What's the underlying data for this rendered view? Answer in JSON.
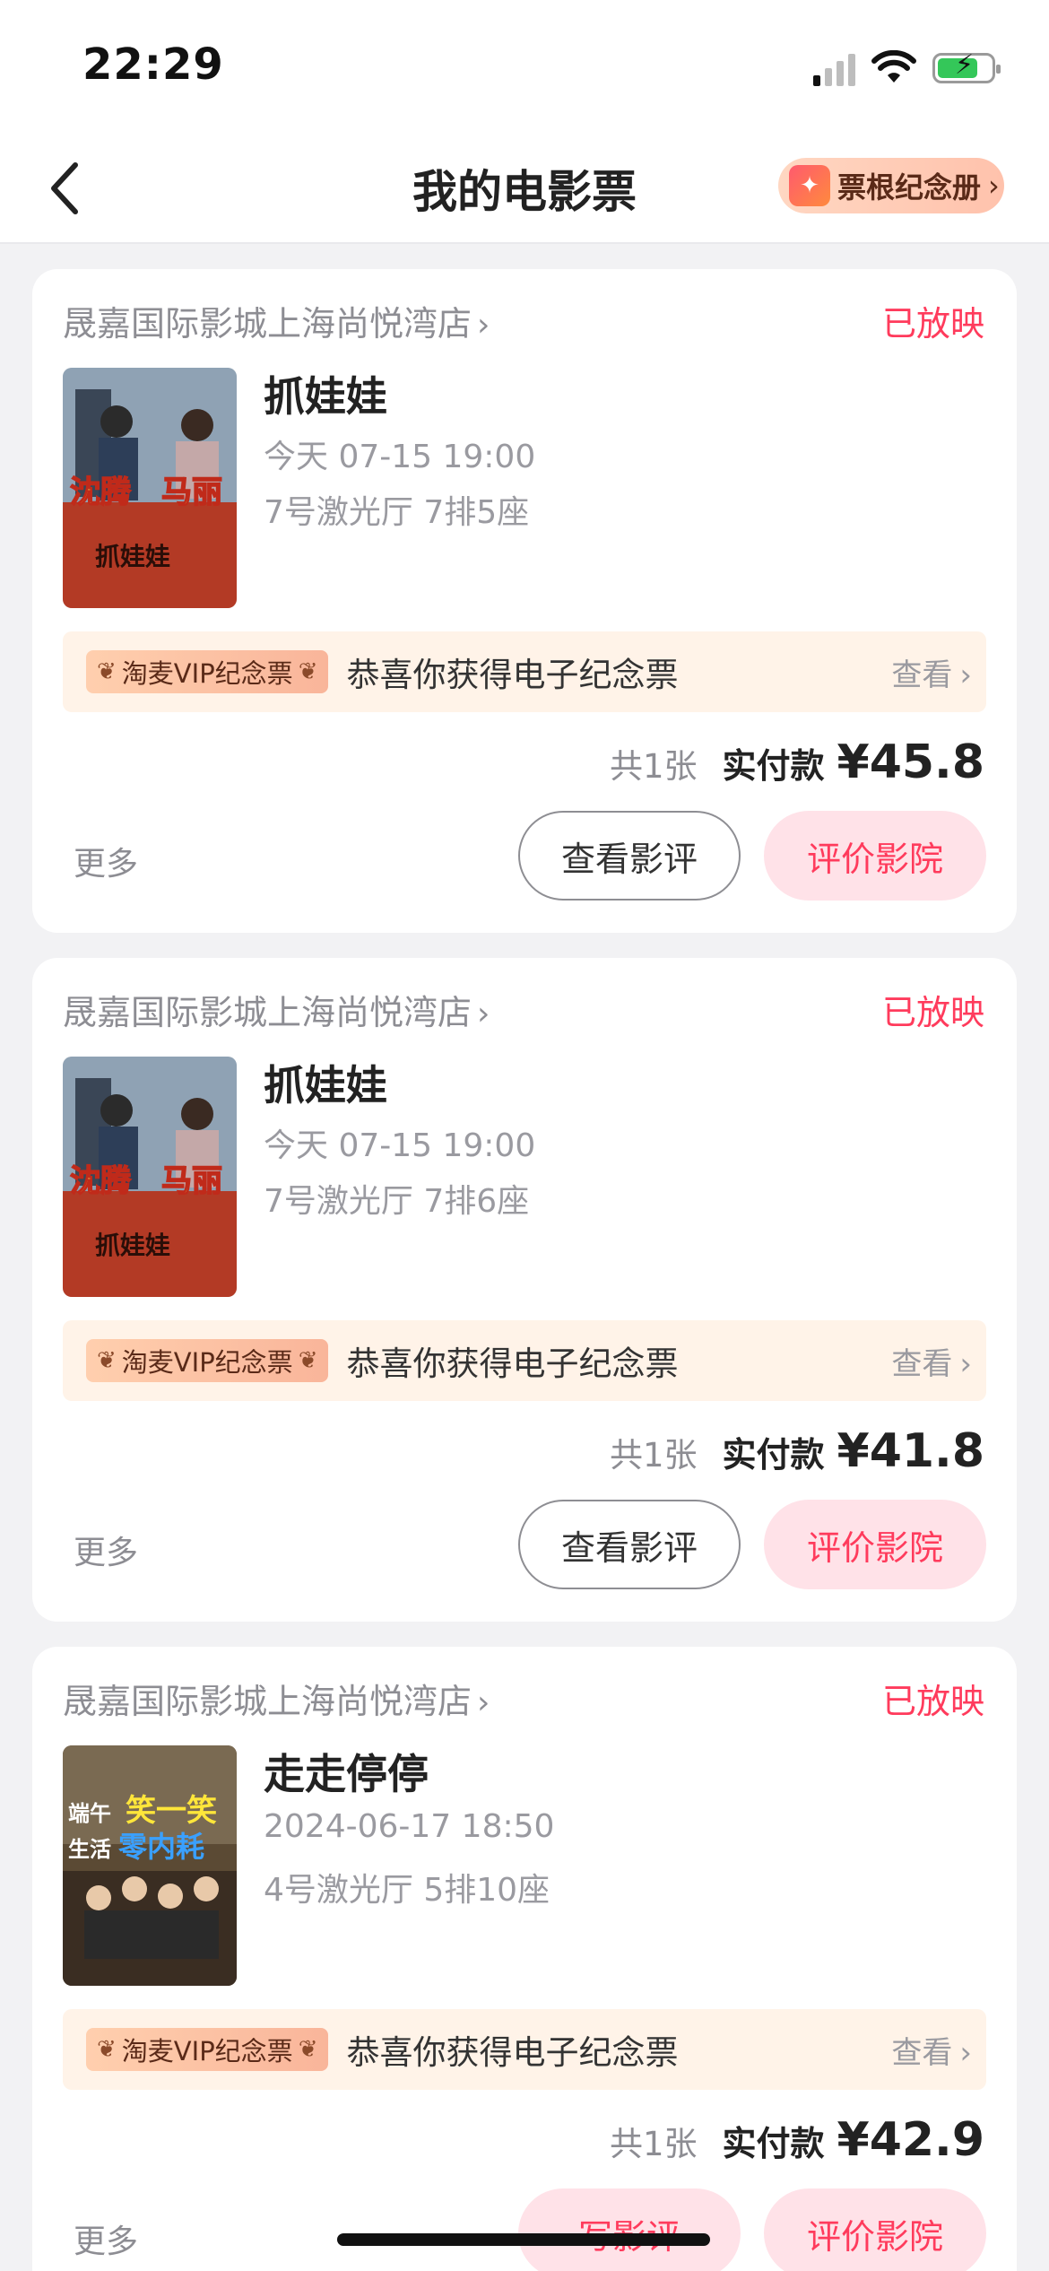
{
  "status_bar": {
    "time": "22:29"
  },
  "nav": {
    "title": "我的电影票",
    "album_button": "票根纪念册",
    "album_chevron": "›"
  },
  "tickets": [
    {
      "cinema": "晟嘉国际影城上海尚悦湾店",
      "state": "已放映",
      "movie": "抓娃娃",
      "time": "今天 07-15 19:00",
      "seat": "7号激光厅 7排5座",
      "poster_text": [
        "沈腾",
        "马丽",
        "抓娃娃"
      ],
      "vip_tag": "淘麦VIP纪念票",
      "vip_message": "恭喜你获得电子纪念票",
      "vip_view": "查看",
      "count": "共1张",
      "paid_label": "实付款",
      "paid_value": "¥45.8",
      "more": "更多",
      "button_1": "查看影评",
      "button_2": "评价影院"
    },
    {
      "cinema": "晟嘉国际影城上海尚悦湾店",
      "state": "已放映",
      "movie": "抓娃娃",
      "time": "今天 07-15 19:00",
      "seat": "7号激光厅 7排6座",
      "poster_text": [
        "沈腾",
        "马丽",
        "抓娃娃"
      ],
      "vip_tag": "淘麦VIP纪念票",
      "vip_message": "恭喜你获得电子纪念票",
      "vip_view": "查看",
      "count": "共1张",
      "paid_label": "实付款",
      "paid_value": "¥41.8",
      "more": "更多",
      "button_1": "查看影评",
      "button_2": "评价影院"
    },
    {
      "cinema": "晟嘉国际影城上海尚悦湾店",
      "state": "已放映",
      "movie": "走走停停",
      "time": "2024-06-17 18:50",
      "seat": "4号激光厅 5排10座",
      "poster_text": [
        "端午",
        "笑一笑",
        "生活",
        "零内耗"
      ],
      "vip_tag": "淘麦VIP纪念票",
      "vip_message": "恭喜你获得电子纪念票",
      "vip_view": "查看",
      "count": "共1张",
      "paid_label": "实付款",
      "paid_value": "¥42.9",
      "more": "更多",
      "button_1": "写影评",
      "button_2": "评价影院"
    }
  ],
  "colors": {
    "accent": "#ff3b5c",
    "pink_button_bg": "#ffe2e8",
    "vip_bar_bg": "#fff3e8",
    "background": "#f2f2f4"
  },
  "icons": [
    "back-arrow-icon",
    "wifi-icon",
    "cellular-signal-icon",
    "battery-charging-icon",
    "sparkle-icon",
    "chevron-right-icon",
    "wheat-icon"
  ]
}
